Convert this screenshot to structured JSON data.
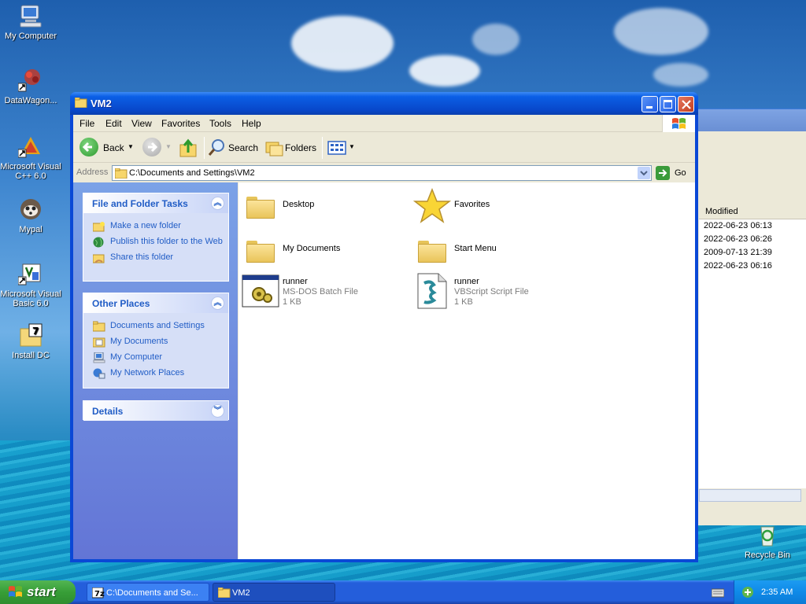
{
  "desktop": {
    "icons": [
      {
        "label": "My Computer"
      },
      {
        "label": "DataWagon..."
      },
      {
        "label": "Microsoft Visual C++ 6.0"
      },
      {
        "label": "Mypal"
      },
      {
        "label": "Microsoft Visual Basic 6.0"
      },
      {
        "label": "Install DC"
      },
      {
        "label": "Recycle Bin"
      }
    ]
  },
  "background_window": {
    "column_header": "Modified",
    "rows": [
      "2022-06-23 06:13",
      "2022-06-23 06:26",
      "2009-07-13 21:39",
      "2022-06-23 06:16"
    ]
  },
  "window": {
    "title": "VM2",
    "menu": [
      "File",
      "Edit",
      "View",
      "Favorites",
      "Tools",
      "Help"
    ],
    "toolbar": {
      "back_label": "Back",
      "search_label": "Search",
      "folders_label": "Folders"
    },
    "address": {
      "label": "Address",
      "value": "C:\\Documents and Settings\\VM2",
      "go_label": "Go"
    }
  },
  "taskpane": {
    "file_tasks": {
      "title": "File and Folder Tasks",
      "items": [
        "Make a new folder",
        "Publish this folder to the Web",
        "Share this folder"
      ]
    },
    "other_places": {
      "title": "Other Places",
      "items": [
        "Documents and Settings",
        "My Documents",
        "My Computer",
        "My Network Places"
      ]
    },
    "details": {
      "title": "Details"
    }
  },
  "files": [
    {
      "name": "Desktop",
      "icon": "folder-icon"
    },
    {
      "name": "Favorites",
      "icon": "star-icon"
    },
    {
      "name": "My Documents",
      "icon": "folder-icon"
    },
    {
      "name": "Start Menu",
      "icon": "folder-icon"
    },
    {
      "name": "runner",
      "type": "MS-DOS Batch File",
      "size": "1 KB",
      "icon": "batch-file-icon"
    },
    {
      "name": "runner",
      "type": "VBScript Script File",
      "size": "1 KB",
      "icon": "vbscript-file-icon"
    }
  ],
  "taskbar": {
    "start_label": "start",
    "tasks": [
      {
        "label": "C:\\Documents and Se..."
      },
      {
        "label": "VM2"
      }
    ],
    "clock": "2:35 AM"
  },
  "colors": {
    "title_blue": "#0a48d6",
    "link_blue": "#215dc6",
    "start_green": "#379e37"
  }
}
